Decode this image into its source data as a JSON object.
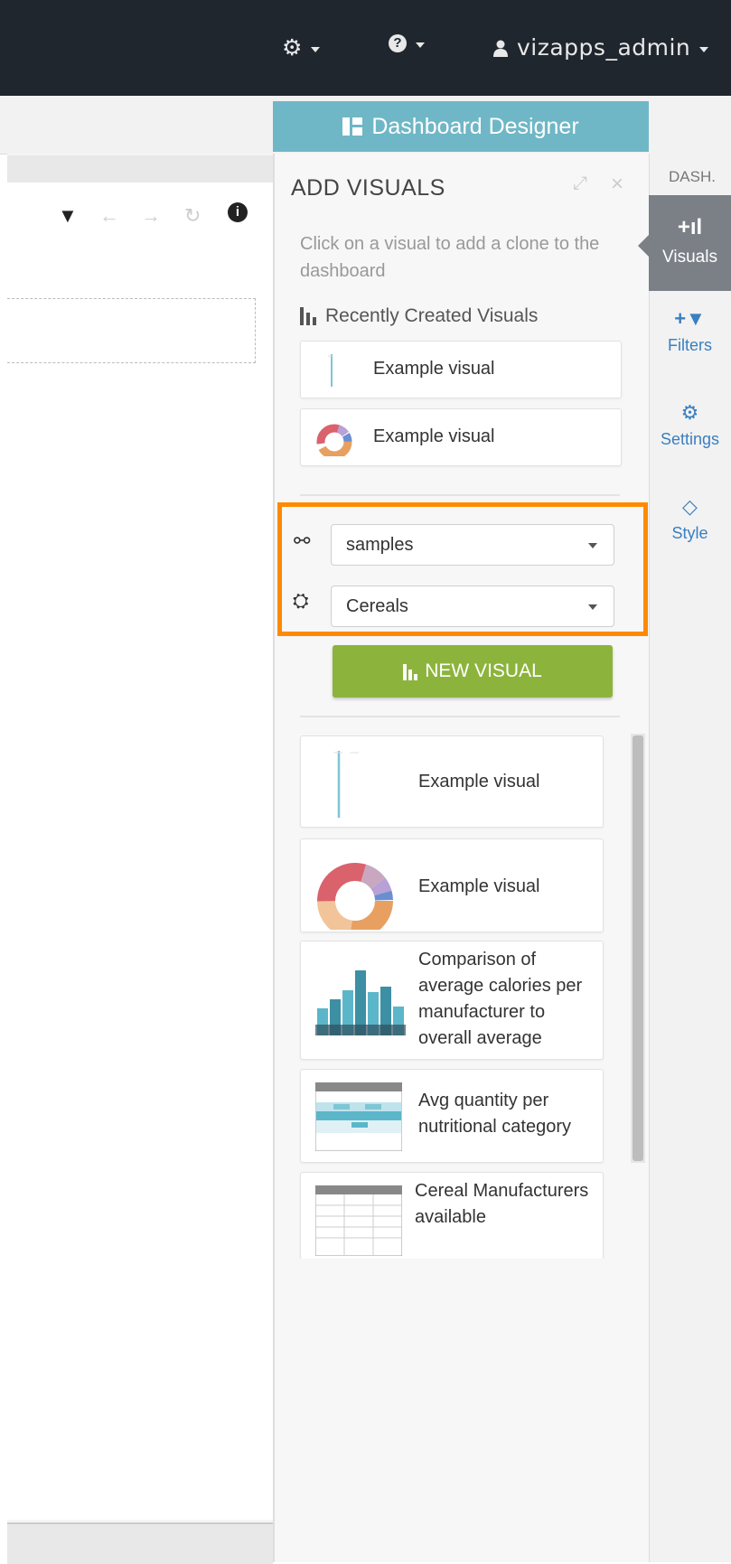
{
  "topbar": {
    "settings_icon": "gear-icon",
    "help_icon": "question-circle-icon",
    "user_icon": "user-icon",
    "username": "vizapps_admin"
  },
  "designer_tab": {
    "label": "Dashboard Designer",
    "icon": "layout-icon"
  },
  "canvas": {
    "toolbar_icons": [
      "filter-icon",
      "undo-icon",
      "redo-icon",
      "refresh-icon",
      "info-icon"
    ]
  },
  "panel": {
    "title": "ADD VISUALS",
    "description": "Click on a visual to add a clone to the dashboard",
    "recent_heading": "Recently Created Visuals",
    "recent_items": [
      {
        "label": "Example visual",
        "thumb": "line-thumb"
      },
      {
        "label": "Example visual",
        "thumb": "donut-thumb"
      }
    ],
    "connection_select": {
      "value": "samples",
      "icon": "link-icon"
    },
    "dataset_select": {
      "value": "Cereals",
      "icon": "cubes-icon"
    },
    "new_visual_button": "NEW VISUAL",
    "visuals": [
      {
        "label": "Example visual",
        "thumb": "line-thumb"
      },
      {
        "label": "Example visual",
        "thumb": "donut-thumb"
      },
      {
        "label": "Comparison of average calories per manufacturer to overall average",
        "thumb": "bar-thumb"
      },
      {
        "label": "Avg quantity per nutritional category",
        "thumb": "table-highlight-thumb"
      },
      {
        "label": "Cereal Manufacturers available",
        "thumb": "table-thumb"
      }
    ]
  },
  "right_nav": {
    "header": "DASH.",
    "items": [
      {
        "label": "Visuals",
        "icon": "add-chart-icon",
        "symbol": "+ıl",
        "active": true
      },
      {
        "label": "Filters",
        "icon": "add-filter-icon",
        "symbol": "+▼",
        "active": false
      },
      {
        "label": "Settings",
        "icon": "gears-icon",
        "symbol": "⚙",
        "active": false
      },
      {
        "label": "Style",
        "icon": "diamond-icon",
        "symbol": "◇",
        "active": false
      }
    ]
  },
  "colors": {
    "topbar": "#1f262d",
    "designer_tab": "#6fb7c6",
    "new_visual_button": "#8cb43c",
    "highlight_border": "#ff8a00",
    "nav_active": "#7b8087",
    "nav_link": "#3a7fc0"
  }
}
